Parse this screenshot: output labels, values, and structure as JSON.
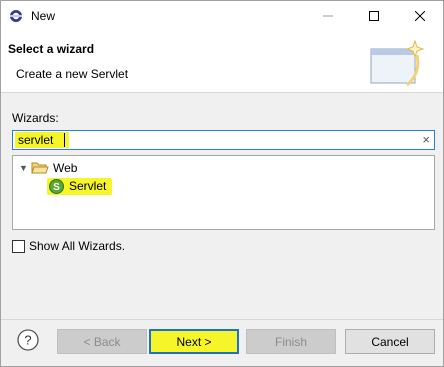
{
  "window": {
    "title": "New",
    "minimize_icon": "minimize-icon",
    "maximize_icon": "maximize-icon",
    "close_icon": "close-icon"
  },
  "header": {
    "title": "Select a wizard",
    "description": "Create a new Servlet"
  },
  "wizards": {
    "label": "Wizards:",
    "filter_value": "servlet",
    "clear_icon": "×"
  },
  "tree": {
    "items": [
      {
        "label": "Web",
        "icon": "folder-open-icon",
        "expanded": true
      },
      {
        "label": "Servlet",
        "icon": "servlet-icon",
        "selected": true
      }
    ]
  },
  "show_all": {
    "label": "Show All Wizards.",
    "checked": false
  },
  "buttons": {
    "help": "?",
    "back": "< Back",
    "next": "Next >",
    "finish": "Finish",
    "cancel": "Cancel"
  },
  "colors": {
    "highlight": "#f5f52a",
    "focus_border": "#2a7fd3",
    "default_button_border": "#1d71c9"
  }
}
